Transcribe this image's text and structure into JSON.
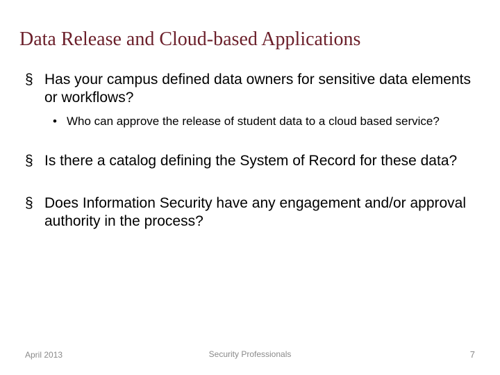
{
  "title": "Data Release and Cloud-based Applications",
  "bullets": [
    {
      "text": "Has your campus defined data owners for sensitive data elements or workflows?",
      "sub": [
        {
          "text": "Who can approve the release of student data to a cloud based service?"
        }
      ]
    },
    {
      "text": "Is there a catalog defining the System of Record for these data?",
      "sub": []
    },
    {
      "text": "Does Information Security have any engagement and/or approval authority in the process?",
      "sub": []
    }
  ],
  "footer": {
    "date": "April 2013",
    "center": "Security Professionals",
    "page": "7"
  }
}
